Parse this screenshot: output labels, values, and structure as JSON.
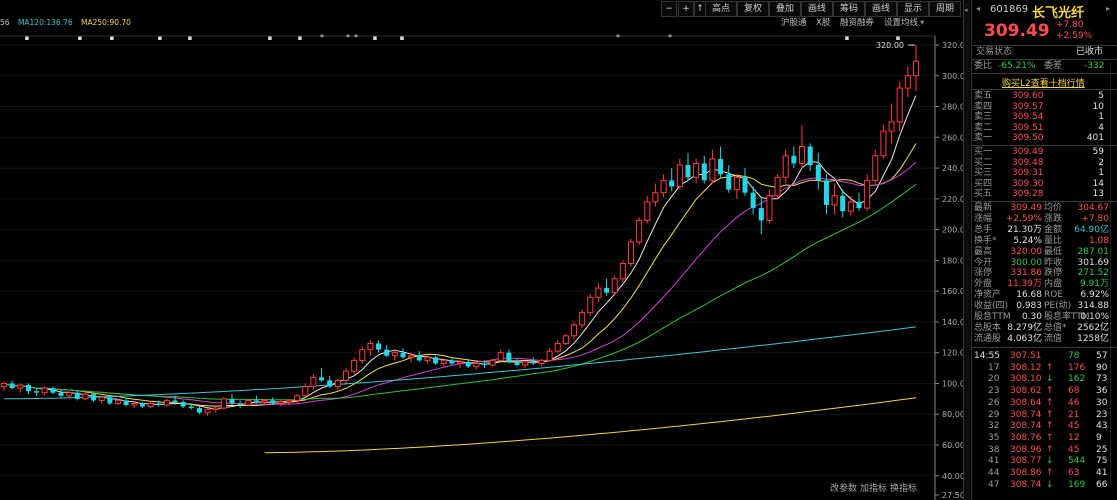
{
  "toolbar": {
    "buttons": [
      "高点",
      "复权",
      "叠加",
      "画线",
      "筹码",
      "画线",
      "显示",
      "周期"
    ],
    "sub_buttons": [
      "沪股通",
      "X股",
      "融资融券",
      "设置均线"
    ],
    "ma_legend": [
      {
        "label": "56",
        "color": "#c8c8c8"
      },
      {
        "label": "MA120:136.76",
        "color": "#39c6d6"
      },
      {
        "label": "MA250:90.70",
        "color": "#f5d442"
      }
    ],
    "bottom": [
      "改参数",
      "加指标",
      "换指标"
    ]
  },
  "chart_data": {
    "type": "candlestick",
    "y_ticks": [
      "320.00",
      "300.00",
      "280.00",
      "260.00",
      "240.00",
      "220.00",
      "200.00",
      "180.00",
      "160.00",
      "140.00",
      "120.00",
      "100.00",
      "80.00",
      "60.00",
      "40.00",
      "27.50"
    ],
    "ylim": [
      27.5,
      328
    ],
    "annotation": "320.00",
    "candles": [
      {
        "o": 98,
        "h": 101,
        "l": 95,
        "c": 100
      },
      {
        "o": 100,
        "h": 102,
        "l": 96,
        "c": 97
      },
      {
        "o": 97,
        "h": 100,
        "l": 94,
        "c": 99
      },
      {
        "o": 99,
        "h": 100,
        "l": 93,
        "c": 95
      },
      {
        "o": 95,
        "h": 97,
        "l": 92,
        "c": 94
      },
      {
        "o": 94,
        "h": 98,
        "l": 92,
        "c": 97
      },
      {
        "o": 97,
        "h": 98,
        "l": 93,
        "c": 94
      },
      {
        "o": 94,
        "h": 96,
        "l": 91,
        "c": 92
      },
      {
        "o": 92,
        "h": 95,
        "l": 90,
        "c": 94
      },
      {
        "o": 94,
        "h": 95,
        "l": 89,
        "c": 90
      },
      {
        "o": 90,
        "h": 94,
        "l": 89,
        "c": 93
      },
      {
        "o": 93,
        "h": 94,
        "l": 88,
        "c": 89
      },
      {
        "o": 89,
        "h": 92,
        "l": 87,
        "c": 91
      },
      {
        "o": 91,
        "h": 92,
        "l": 86,
        "c": 87
      },
      {
        "o": 87,
        "h": 90,
        "l": 86,
        "c": 89
      },
      {
        "o": 89,
        "h": 90,
        "l": 85,
        "c": 86
      },
      {
        "o": 86,
        "h": 88,
        "l": 84,
        "c": 87
      },
      {
        "o": 87,
        "h": 88,
        "l": 84,
        "c": 85
      },
      {
        "o": 85,
        "h": 88,
        "l": 84,
        "c": 87
      },
      {
        "o": 87,
        "h": 89,
        "l": 85,
        "c": 86
      },
      {
        "o": 86,
        "h": 90,
        "l": 85,
        "c": 89
      },
      {
        "o": 89,
        "h": 92,
        "l": 86,
        "c": 88
      },
      {
        "o": 88,
        "h": 89,
        "l": 84,
        "c": 85
      },
      {
        "o": 85,
        "h": 87,
        "l": 83,
        "c": 84
      },
      {
        "o": 84,
        "h": 85,
        "l": 80,
        "c": 81
      },
      {
        "o": 81,
        "h": 84,
        "l": 79,
        "c": 83
      },
      {
        "o": 83,
        "h": 86,
        "l": 81,
        "c": 84
      },
      {
        "o": 84,
        "h": 91,
        "l": 83,
        "c": 90
      },
      {
        "o": 90,
        "h": 93,
        "l": 86,
        "c": 87
      },
      {
        "o": 87,
        "h": 89,
        "l": 84,
        "c": 86
      },
      {
        "o": 86,
        "h": 90,
        "l": 85,
        "c": 89
      },
      {
        "o": 89,
        "h": 92,
        "l": 87,
        "c": 88
      },
      {
        "o": 88,
        "h": 90,
        "l": 86,
        "c": 89
      },
      {
        "o": 89,
        "h": 91,
        "l": 86,
        "c": 87
      },
      {
        "o": 87,
        "h": 89,
        "l": 85,
        "c": 88
      },
      {
        "o": 88,
        "h": 90,
        "l": 86,
        "c": 89
      },
      {
        "o": 89,
        "h": 93,
        "l": 87,
        "c": 92
      },
      {
        "o": 92,
        "h": 100,
        "l": 91,
        "c": 98
      },
      {
        "o": 98,
        "h": 106,
        "l": 96,
        "c": 104
      },
      {
        "o": 104,
        "h": 110,
        "l": 101,
        "c": 102
      },
      {
        "o": 102,
        "h": 105,
        "l": 97,
        "c": 98
      },
      {
        "o": 98,
        "h": 103,
        "l": 96,
        "c": 102
      },
      {
        "o": 102,
        "h": 110,
        "l": 100,
        "c": 108
      },
      {
        "o": 108,
        "h": 117,
        "l": 106,
        "c": 115
      },
      {
        "o": 115,
        "h": 124,
        "l": 113,
        "c": 122
      },
      {
        "o": 122,
        "h": 128,
        "l": 118,
        "c": 126
      },
      {
        "o": 126,
        "h": 128,
        "l": 120,
        "c": 122
      },
      {
        "o": 122,
        "h": 125,
        "l": 117,
        "c": 118
      },
      {
        "o": 118,
        "h": 122,
        "l": 115,
        "c": 120
      },
      {
        "o": 120,
        "h": 123,
        "l": 116,
        "c": 117
      },
      {
        "o": 117,
        "h": 120,
        "l": 114,
        "c": 118
      },
      {
        "o": 118,
        "h": 121,
        "l": 114,
        "c": 115
      },
      {
        "o": 115,
        "h": 119,
        "l": 113,
        "c": 117
      },
      {
        "o": 117,
        "h": 118,
        "l": 112,
        "c": 113
      },
      {
        "o": 113,
        "h": 116,
        "l": 111,
        "c": 115
      },
      {
        "o": 115,
        "h": 117,
        "l": 112,
        "c": 113
      },
      {
        "o": 113,
        "h": 115,
        "l": 110,
        "c": 114
      },
      {
        "o": 114,
        "h": 116,
        "l": 110,
        "c": 111
      },
      {
        "o": 111,
        "h": 114,
        "l": 109,
        "c": 113
      },
      {
        "o": 113,
        "h": 115,
        "l": 110,
        "c": 112
      },
      {
        "o": 112,
        "h": 116,
        "l": 111,
        "c": 115
      },
      {
        "o": 115,
        "h": 122,
        "l": 114,
        "c": 120
      },
      {
        "o": 120,
        "h": 122,
        "l": 113,
        "c": 114
      },
      {
        "o": 114,
        "h": 116,
        "l": 111,
        "c": 112
      },
      {
        "o": 112,
        "h": 115,
        "l": 110,
        "c": 114
      },
      {
        "o": 114,
        "h": 117,
        "l": 112,
        "c": 113
      },
      {
        "o": 113,
        "h": 116,
        "l": 111,
        "c": 115
      },
      {
        "o": 115,
        "h": 123,
        "l": 114,
        "c": 121
      },
      {
        "o": 121,
        "h": 128,
        "l": 120,
        "c": 126
      },
      {
        "o": 126,
        "h": 132,
        "l": 125,
        "c": 131
      },
      {
        "o": 131,
        "h": 140,
        "l": 129,
        "c": 138
      },
      {
        "o": 138,
        "h": 148,
        "l": 136,
        "c": 146
      },
      {
        "o": 146,
        "h": 158,
        "l": 144,
        "c": 156
      },
      {
        "o": 156,
        "h": 165,
        "l": 153,
        "c": 162
      },
      {
        "o": 162,
        "h": 168,
        "l": 157,
        "c": 159
      },
      {
        "o": 159,
        "h": 170,
        "l": 158,
        "c": 168
      },
      {
        "o": 168,
        "h": 180,
        "l": 166,
        "c": 178
      },
      {
        "o": 178,
        "h": 194,
        "l": 176,
        "c": 192
      },
      {
        "o": 192,
        "h": 208,
        "l": 190,
        "c": 206
      },
      {
        "o": 206,
        "h": 222,
        "l": 204,
        "c": 218
      },
      {
        "o": 218,
        "h": 230,
        "l": 215,
        "c": 224
      },
      {
        "o": 224,
        "h": 236,
        "l": 221,
        "c": 232
      },
      {
        "o": 232,
        "h": 240,
        "l": 225,
        "c": 228
      },
      {
        "o": 228,
        "h": 246,
        "l": 226,
        "c": 242
      },
      {
        "o": 242,
        "h": 250,
        "l": 232,
        "c": 234
      },
      {
        "o": 234,
        "h": 246,
        "l": 230,
        "c": 243
      },
      {
        "o": 243,
        "h": 248,
        "l": 230,
        "c": 232
      },
      {
        "o": 232,
        "h": 252,
        "l": 230,
        "c": 246
      },
      {
        "o": 246,
        "h": 254,
        "l": 234,
        "c": 236
      },
      {
        "o": 236,
        "h": 242,
        "l": 224,
        "c": 226
      },
      {
        "o": 226,
        "h": 236,
        "l": 220,
        "c": 234
      },
      {
        "o": 234,
        "h": 240,
        "l": 222,
        "c": 224
      },
      {
        "o": 224,
        "h": 228,
        "l": 210,
        "c": 214
      },
      {
        "o": 214,
        "h": 220,
        "l": 197,
        "c": 206
      },
      {
        "o": 206,
        "h": 226,
        "l": 204,
        "c": 222
      },
      {
        "o": 222,
        "h": 236,
        "l": 220,
        "c": 234
      },
      {
        "o": 234,
        "h": 252,
        "l": 230,
        "c": 248
      },
      {
        "o": 248,
        "h": 254,
        "l": 240,
        "c": 243
      },
      {
        "o": 243,
        "h": 268,
        "l": 240,
        "c": 254
      },
      {
        "o": 254,
        "h": 256,
        "l": 238,
        "c": 242
      },
      {
        "o": 242,
        "h": 250,
        "l": 226,
        "c": 232
      },
      {
        "o": 232,
        "h": 236,
        "l": 210,
        "c": 216
      },
      {
        "o": 216,
        "h": 230,
        "l": 210,
        "c": 222
      },
      {
        "o": 222,
        "h": 226,
        "l": 208,
        "c": 212
      },
      {
        "o": 212,
        "h": 222,
        "l": 209,
        "c": 218
      },
      {
        "o": 218,
        "h": 224,
        "l": 212,
        "c": 214
      },
      {
        "o": 214,
        "h": 236,
        "l": 212,
        "c": 232
      },
      {
        "o": 232,
        "h": 252,
        "l": 230,
        "c": 248
      },
      {
        "o": 248,
        "h": 268,
        "l": 246,
        "c": 264
      },
      {
        "o": 264,
        "h": 282,
        "l": 256,
        "c": 270
      },
      {
        "o": 270,
        "h": 296,
        "l": 264,
        "c": 292
      },
      {
        "o": 292,
        "h": 306,
        "l": 286,
        "c": 300
      },
      {
        "o": 300,
        "h": 320,
        "l": 290,
        "c": 309.49
      }
    ],
    "ma_lines": [
      {
        "name": "MA5",
        "color": "#e8e8e8"
      },
      {
        "name": "MA10",
        "color": "#f0e04a"
      },
      {
        "name": "MA20",
        "color": "#d040d8"
      },
      {
        "name": "MA60",
        "color": "#30c030"
      },
      {
        "name": "MA120",
        "color": "#39c6d6",
        "start": 90,
        "end": 136.76
      },
      {
        "name": "MA250",
        "color": "#f5d442",
        "start": 55,
        "end": 90.7
      }
    ]
  },
  "quote": {
    "code": "601869",
    "name": "长飞光纤",
    "price": "309.49",
    "change": "+7.80",
    "change_pct": "+2.59%",
    "status_label": "交易状态",
    "status_value": "已收市",
    "weibi_label": "委比",
    "weibi_value": "-65.21%",
    "weicha_label": "委差",
    "weicha_value": "-332",
    "l2_link": "购买L2查看十档行情",
    "asks": [
      {
        "label": "卖五",
        "price": "309.60",
        "vol": "5"
      },
      {
        "label": "卖四",
        "price": "309.57",
        "vol": "10"
      },
      {
        "label": "卖三",
        "price": "309.54",
        "vol": "1"
      },
      {
        "label": "卖二",
        "price": "309.51",
        "vol": "4"
      },
      {
        "label": "卖一",
        "price": "309.50",
        "vol": "401"
      }
    ],
    "bids": [
      {
        "label": "买一",
        "price": "309.49",
        "vol": "59"
      },
      {
        "label": "买二",
        "price": "309.48",
        "vol": "2"
      },
      {
        "label": "买三",
        "price": "309.31",
        "vol": "1"
      },
      {
        "label": "买四",
        "price": "309.30",
        "vol": "14"
      },
      {
        "label": "买五",
        "price": "309.28",
        "vol": "13"
      }
    ],
    "stats": [
      {
        "l1": "最新",
        "v1": "309.49",
        "c1": "red",
        "l2": "均价",
        "v2": "304.67",
        "c2": "red"
      },
      {
        "l1": "涨幅",
        "v1": "+2.59%",
        "c1": "red",
        "l2": "涨跌",
        "v2": "+7.80",
        "c2": "red"
      },
      {
        "l1": "总手",
        "v1": "21.30万",
        "c1": "wht",
        "l2": "金额",
        "v2": "64.90亿",
        "c2": "cyan"
      },
      {
        "l1": "换手*",
        "v1": "5.24%",
        "c1": "wht",
        "l2": "量比",
        "v2": "1.08",
        "c2": "red"
      },
      {
        "l1": "最高",
        "v1": "320.00",
        "c1": "red",
        "l2": "最低",
        "v2": "287.01",
        "c2": "grn"
      },
      {
        "l1": "今开",
        "v1": "300.00",
        "c1": "grn",
        "l2": "昨收",
        "v2": "301.69",
        "c2": "wht"
      },
      {
        "l1": "涨停",
        "v1": "331.86",
        "c1": "red",
        "l2": "跌停",
        "v2": "271.52",
        "c2": "grn"
      },
      {
        "l1": "外盘",
        "v1": "11.39万",
        "c1": "red",
        "l2": "内盘",
        "v2": "9.91万",
        "c2": "grn"
      },
      {
        "l1": "净资产",
        "v1": "16.68",
        "c1": "wht",
        "l2": "ROE",
        "v2": "6.92%",
        "c2": "wht"
      },
      {
        "l1": "收益(四)",
        "v1": "0.983",
        "c1": "wht",
        "l2": "PE(动)",
        "v2": "314.88",
        "c2": "wht"
      },
      {
        "l1": "股息TTM",
        "v1": "0.30",
        "c1": "wht",
        "l2": "股息率TTM",
        "v2": "0.10%",
        "c2": "wht"
      },
      {
        "l1": "总股本",
        "v1": "8.279亿",
        "c1": "wht",
        "l2": "总值*",
        "v2": "2562亿",
        "c2": "wht"
      },
      {
        "l1": "流通股",
        "v1": "4.063亿",
        "c1": "wht",
        "l2": "流值",
        "v2": "1258亿",
        "c2": "wht"
      }
    ],
    "ticks_header": {
      "time": "14:55",
      "price": "307.51",
      "vol": "78",
      "n": "57"
    },
    "ticks": [
      {
        "t": "17",
        "p": "308.12",
        "d": "↑",
        "v": "176",
        "n": "90",
        "vc": "red"
      },
      {
        "t": "20",
        "p": "308.10",
        "d": "↓",
        "v": "162",
        "n": "73",
        "vc": "grn"
      },
      {
        "t": "23",
        "p": "308.62",
        "d": "↑",
        "v": "68",
        "n": "36",
        "vc": "red"
      },
      {
        "t": "26",
        "p": "308.64",
        "d": "↑",
        "v": "46",
        "n": "30",
        "vc": "red"
      },
      {
        "t": "29",
        "p": "308.74",
        "d": "↑",
        "v": "21",
        "n": "23",
        "vc": "red"
      },
      {
        "t": "32",
        "p": "308.74",
        "d": "↑",
        "v": "45",
        "n": "43",
        "vc": "red"
      },
      {
        "t": "35",
        "p": "308.76",
        "d": "↑",
        "v": "12",
        "n": "9",
        "vc": "red"
      },
      {
        "t": "38",
        "p": "308.96",
        "d": "↑",
        "v": "45",
        "n": "25",
        "vc": "red"
      },
      {
        "t": "41",
        "p": "308.77",
        "d": "↓",
        "v": "544",
        "n": "75",
        "vc": "grn"
      },
      {
        "t": "44",
        "p": "308.86",
        "d": "↑",
        "v": "63",
        "n": "41",
        "vc": "red"
      },
      {
        "t": "47",
        "p": "308.74",
        "d": "↓",
        "v": "169",
        "n": "66",
        "vc": "grn"
      }
    ]
  }
}
